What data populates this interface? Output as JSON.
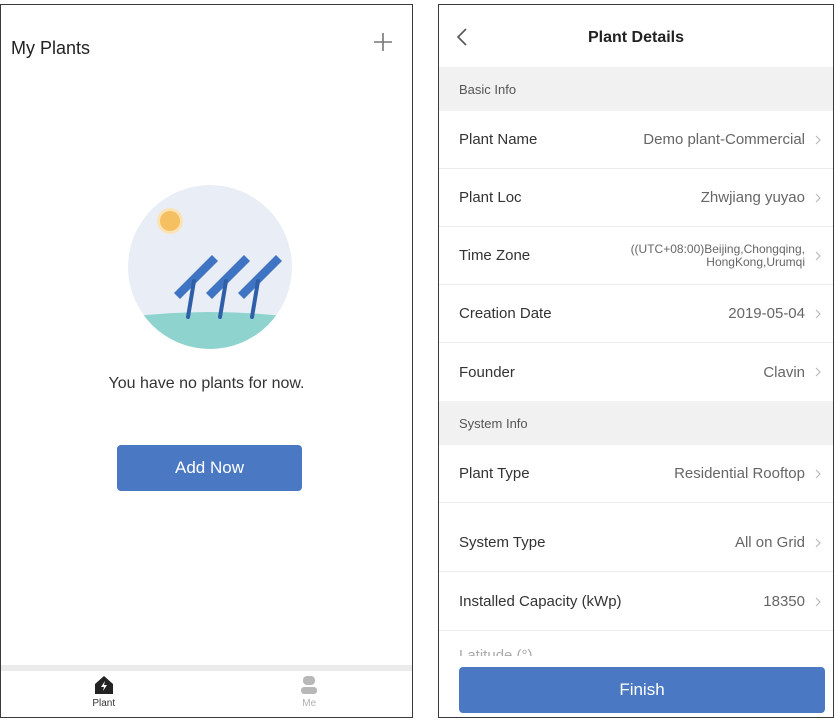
{
  "left_screen": {
    "title": "My Plants",
    "add_icon": "plus-icon",
    "empty_message": "You have no plants for now.",
    "add_button_label": "Add Now",
    "tabs": [
      {
        "label": "Plant",
        "icon": "plant-home-icon",
        "active": true
      },
      {
        "label": "Me",
        "icon": "person-icon",
        "active": false
      }
    ]
  },
  "right_screen": {
    "title": "Plant Details",
    "back_icon": "chevron-left-icon",
    "sections": [
      {
        "title": "Basic Info",
        "rows": [
          {
            "label": "Plant Name",
            "value": "Demo plant-Commercial"
          },
          {
            "label": "Plant Loc",
            "value": "Zhwjiang yuyao"
          },
          {
            "label": "Time Zone",
            "value_line1": "((UTC+08:00)Beijing,Chongqing,",
            "value_line2": "HongKong,Urumqi"
          },
          {
            "label": "Creation Date",
            "value": "2019-05-04"
          },
          {
            "label": "Founder",
            "value": "Clavin"
          }
        ]
      },
      {
        "title": "System Info",
        "rows": [
          {
            "label": "Plant Type",
            "value": "Residential Rooftop"
          },
          {
            "label": "System Type",
            "value": "All on Grid"
          },
          {
            "label": "Installed Capacity (kWp)",
            "value": "18350"
          }
        ]
      }
    ],
    "cut_off_row_label": "Latitude (°)",
    "finish_button_label": "Finish"
  },
  "colors": {
    "accent": "#4a78c2",
    "section_bg": "#f1f1f1",
    "illustration_bg": "#e9eef6",
    "illustration_ground": "#8fd3cf",
    "sun": "#f5c061",
    "panel": "#3f74c2"
  }
}
